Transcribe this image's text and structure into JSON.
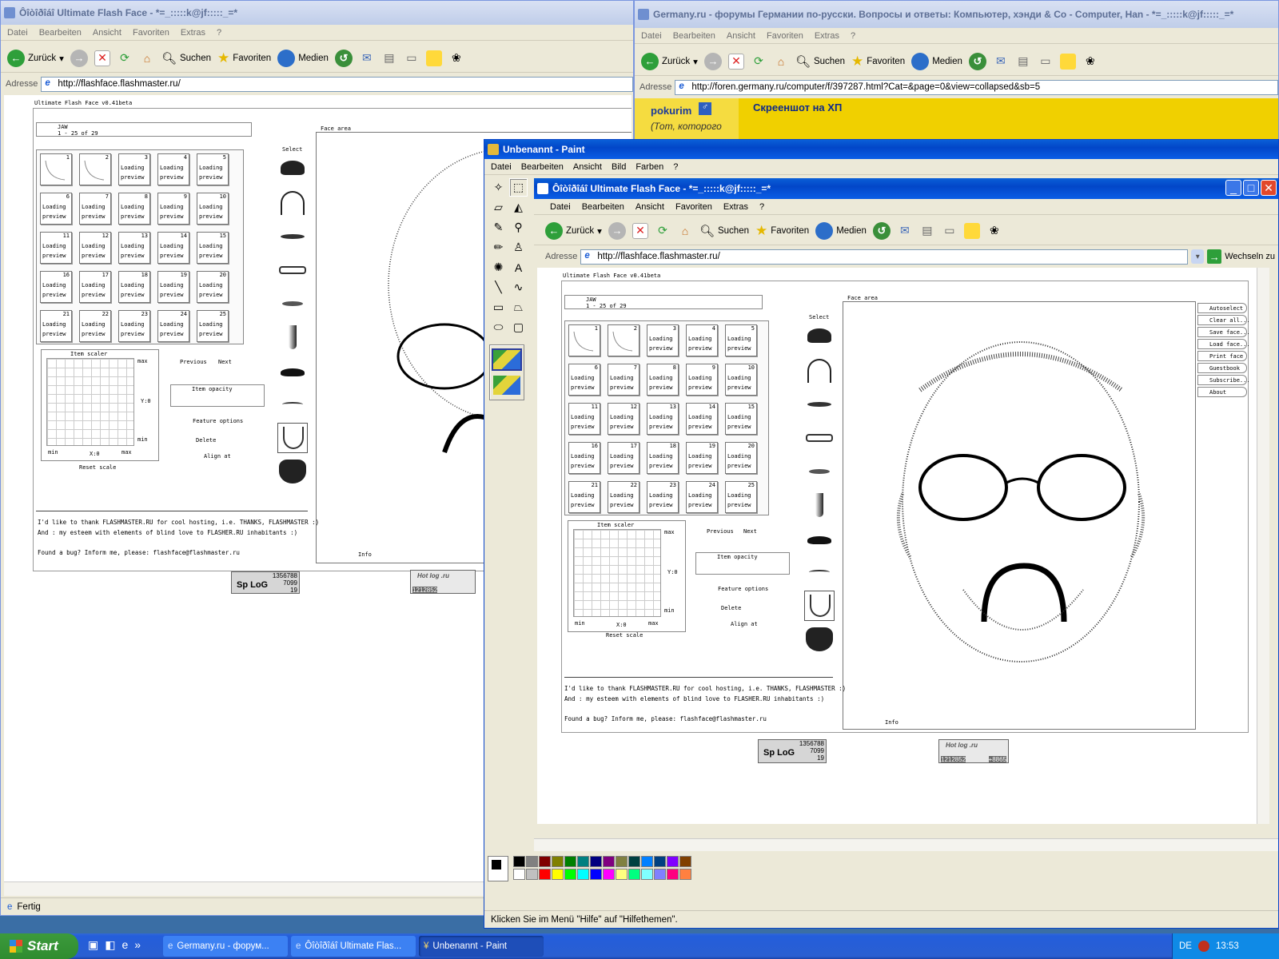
{
  "desktop_color": "#3a6ea5",
  "window_left": {
    "title": "Ôîòîðîáî Ultimate Flash Face - *=_:::::k@jf:::::_=*",
    "menu": [
      "Datei",
      "Bearbeiten",
      "Ansicht",
      "Favoriten",
      "Extras",
      "?"
    ],
    "toolbar": {
      "back": "Zurück",
      "search": "Suchen",
      "favorites": "Favoriten",
      "media": "Medien"
    },
    "address_label": "Adresse",
    "address_url": "http://flashface.flashmaster.ru/",
    "status": "Fertig"
  },
  "window_right": {
    "title": "Germany.ru - форумы Германии по-русски. Вопросы и ответы: Компьютер, хэнди & Co - Computer, Han - *=_:::::k@jf:::::_=*",
    "menu": [
      "Datei",
      "Bearbeiten",
      "Ansicht",
      "Favoriten",
      "Extras",
      "?"
    ],
    "toolbar": {
      "back": "Zurück",
      "search": "Suchen",
      "favorites": "Favoriten",
      "media": "Medien"
    },
    "address_label": "Adresse",
    "address_url": "http://foren.germany.ru/computer/f/397287.html?Cat=&page=0&view=collapsed&sb=5",
    "forum_user": "pokurim",
    "forum_user_sub": "(Тот, которого",
    "forum_subject": "Скреeншот на ХП"
  },
  "paint_window": {
    "title": "Unbenannt - Paint",
    "menu": [
      "Datei",
      "Bearbeiten",
      "Ansicht",
      "Bild",
      "Farben",
      "?"
    ],
    "status": "Klicken Sie im Menü \"Hilfe\" auf \"Hilfethemen\".",
    "palette": [
      "#000000",
      "#808080",
      "#800000",
      "#808000",
      "#008000",
      "#008080",
      "#000080",
      "#800080",
      "#808040",
      "#004040",
      "#0080ff",
      "#004080",
      "#8000ff",
      "#804000",
      "#ffffff",
      "#c0c0c0",
      "#ff0000",
      "#ffff00",
      "#00ff00",
      "#00ffff",
      "#0000ff",
      "#ff00ff",
      "#ffff80",
      "#00ff80",
      "#80ffff",
      "#8080ff",
      "#ff0080",
      "#ff8040"
    ]
  },
  "inner_window": {
    "title": "Ôîòîðîáî Ultimate Flash Face - *=_:::::k@jf:::::_=*",
    "menu": [
      "Datei",
      "Bearbeiten",
      "Ansicht",
      "Favoriten",
      "Extras",
      "?"
    ],
    "toolbar": {
      "back": "Zurück",
      "search": "Suchen",
      "favorites": "Favoriten",
      "media": "Medien"
    },
    "address_label": "Adresse",
    "address_url": "http://flashface.flashmaster.ru/",
    "go_label": "Wechseln zu"
  },
  "flashface": {
    "version": "Ultimate Flash Face v0.41beta",
    "category": "JAW",
    "range": "1 - 25 of 29",
    "select": "Select",
    "face_area": "Face area",
    "loading": "Loading",
    "preview": "preview",
    "previous": "Previous",
    "next": "Next",
    "item_scaler": "Item scaler",
    "max": "max",
    "min": "min",
    "y0": "Y:0",
    "x0": "X:0",
    "reset_scale": "Reset scale",
    "item_opacity": "Item opacity",
    "feature_options": "Feature options",
    "delete": "Delete",
    "align_at": "Align at",
    "info": "Info",
    "thanks1": "I'd like to thank FLASHMASTER.RU for cool hosting, i.e. THANKS, FLASHMASTER :)",
    "thanks2": "And : my esteem with elements of blind love to FLASHER.RU inhabitants :)",
    "bug": "Found a bug? Inform me, please: flashface@flashmaster.ru",
    "side_buttons": [
      "Autoselect",
      "Clear all...",
      "Save face...",
      "Load face...",
      "Print face",
      "Guestbook",
      "Subscribe...",
      "About"
    ],
    "counter_spylog": {
      "top": "1356788",
      "mid": "7099",
      "low": "19",
      "logo": "Sp LoG"
    },
    "counter_hotlog": {
      "logo": "Hot log .ru",
      "a": "1212852",
      "b": "+8865"
    }
  },
  "taskbar": {
    "start": "Start",
    "tasks": [
      "Germany.ru - форум...",
      "Ôîòîðîáî Ultimate Flas...",
      "Unbenannt - Paint"
    ],
    "lang": "DE",
    "time": "13:53"
  }
}
